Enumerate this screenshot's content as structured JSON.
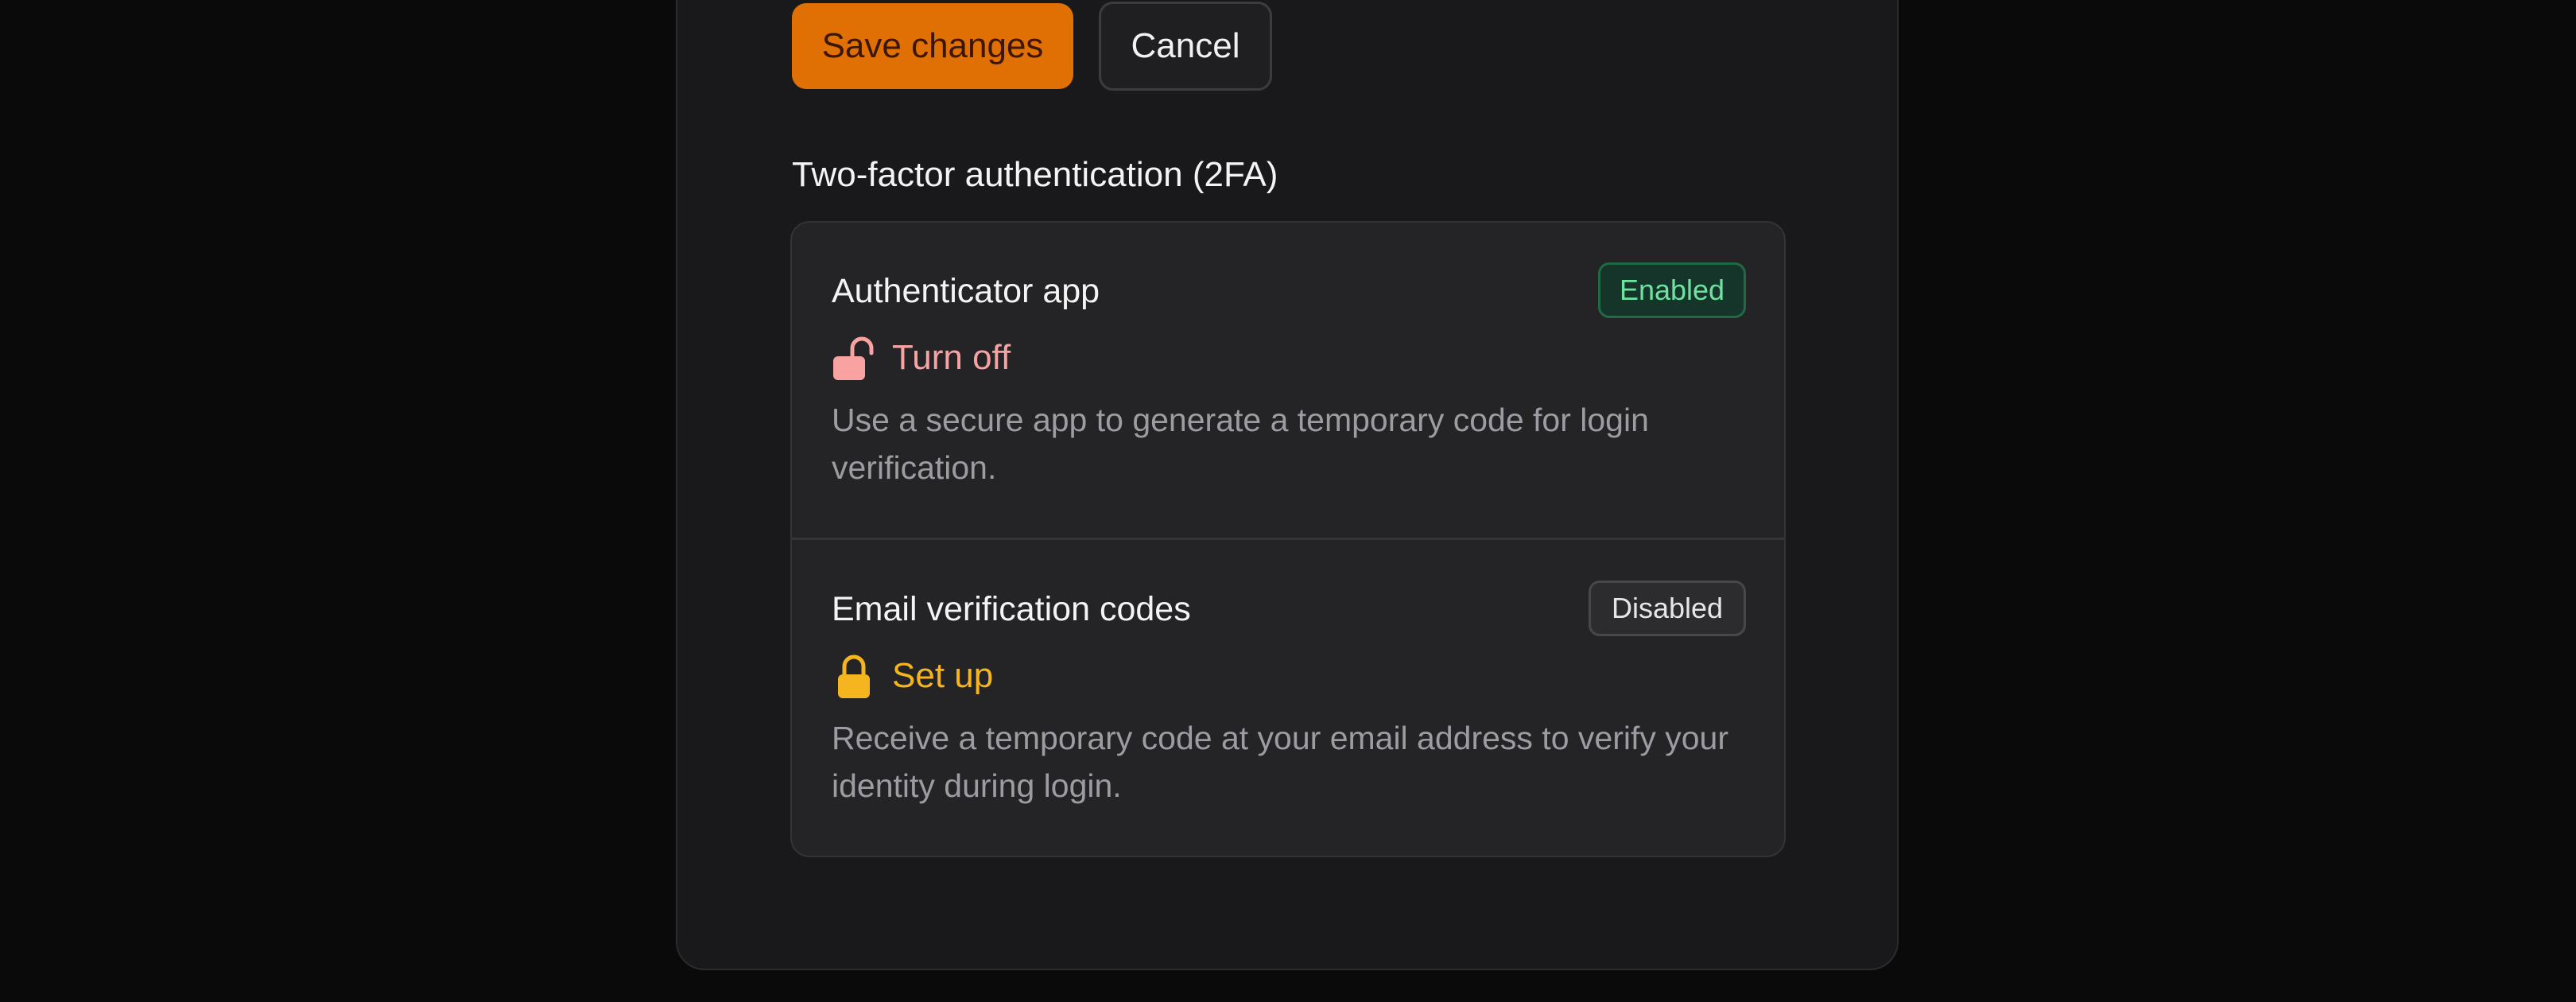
{
  "actions": {
    "save_label": "Save changes",
    "cancel_label": "Cancel"
  },
  "two_factor": {
    "title": "Two-factor authentication (2FA)",
    "methods": [
      {
        "name": "Authenticator app",
        "status": "Enabled",
        "action": "Turn off",
        "action_icon": "unlock-icon",
        "description": "Use a secure app to generate a temporary code for login verification."
      },
      {
        "name": "Email verification codes",
        "status": "Disabled",
        "action": "Set up",
        "action_icon": "lock-icon",
        "description": "Receive a temporary code at your email address to verify your identity during login."
      }
    ]
  },
  "colors": {
    "primary": "#e07004",
    "enabled": "#6ee3a0",
    "danger": "#f8a2a2",
    "warning": "#f5b51e"
  }
}
